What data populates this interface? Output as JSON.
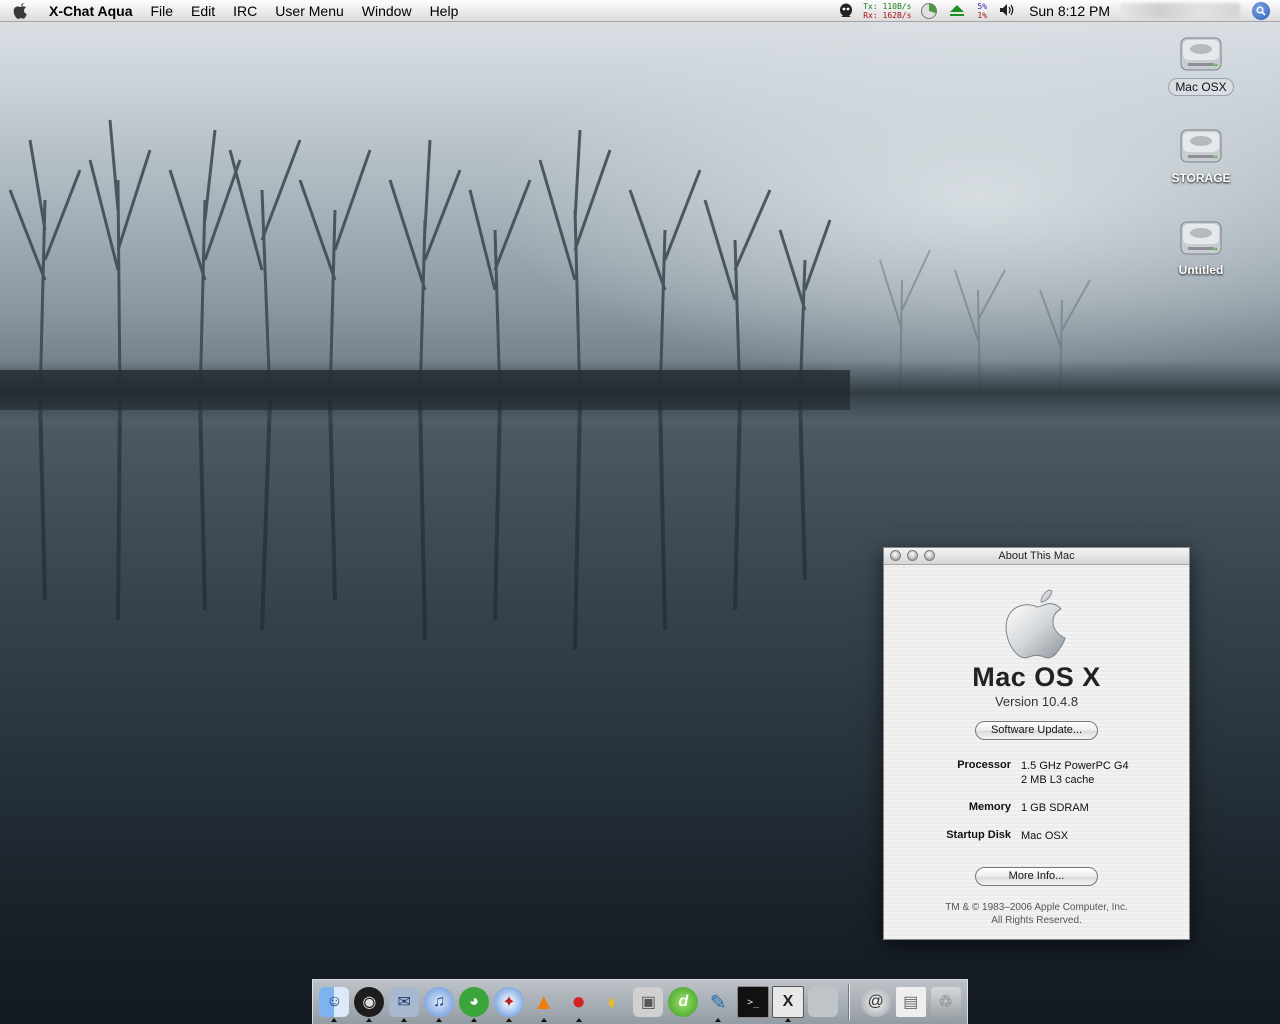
{
  "menubar": {
    "app_name": "X-Chat Aqua",
    "menus": [
      "File",
      "Edit",
      "IRC",
      "User Menu",
      "Window",
      "Help"
    ],
    "net_tx_label": "Tx:",
    "net_tx_value": "110B/s",
    "net_rx_label": "Rx:",
    "net_rx_value": "162B/s",
    "cpu_user": "5%",
    "cpu_sys": "1%",
    "clock": "Sun 8:12 PM",
    "icons": [
      "apple-icon",
      "monitor-eye-icon",
      "pie-chart-icon",
      "upload-arrow-icon",
      "volume-icon",
      "spotlight-icon"
    ]
  },
  "desktop_icons": [
    {
      "label": "Mac OSX",
      "selected": true,
      "icon": "hard-disk-icon"
    },
    {
      "label": "STORAGE",
      "selected": false,
      "icon": "hard-disk-icon"
    },
    {
      "label": "Untitled",
      "selected": false,
      "icon": "hard-disk-icon"
    }
  ],
  "about_window": {
    "title": "About This Mac",
    "os_name": "Mac OS X",
    "version": "Version 10.4.8",
    "software_update_button": "Software Update...",
    "processor_label": "Processor",
    "processor_line1": "1.5 GHz PowerPC G4",
    "processor_line2": "2 MB L3 cache",
    "memory_label": "Memory",
    "memory_value": "1 GB SDRAM",
    "startup_disk_label": "Startup Disk",
    "startup_disk_value": "Mac OSX",
    "more_info_button": "More Info...",
    "copyright_line1": "TM & © 1983–2006 Apple Computer, Inc.",
    "copyright_line2": "All Rights Reserved."
  },
  "dock": {
    "apps": [
      {
        "icon": "finder-icon",
        "glyph": "☺",
        "running": true
      },
      {
        "icon": "dashboard-icon",
        "glyph": "◉",
        "running": true
      },
      {
        "icon": "mail-icon",
        "glyph": "✉",
        "running": true
      },
      {
        "icon": "itunes-icon",
        "glyph": "♫",
        "running": true
      },
      {
        "icon": "adium-icon",
        "glyph": "◕",
        "running": true
      },
      {
        "icon": "safari-compass-icon",
        "glyph": "✦",
        "running": true
      },
      {
        "icon": "vlc-cone-icon",
        "glyph": "▲",
        "running": true
      },
      {
        "icon": "tomato-icon",
        "glyph": "●",
        "running": true
      },
      {
        "icon": "cyberduck-icon",
        "glyph": "◐",
        "running": false
      },
      {
        "icon": "dvd-player-icon",
        "glyph": "▣",
        "running": false
      },
      {
        "icon": "dreamweaver-icon",
        "glyph": "d",
        "running": false
      },
      {
        "icon": "feather-icon",
        "glyph": "✎",
        "running": true
      },
      {
        "icon": "terminal-icon",
        "glyph": ">_",
        "running": false
      },
      {
        "icon": "x11-icon",
        "glyph": "X",
        "running": true
      },
      {
        "icon": "system-preferences-icon",
        "glyph": "",
        "running": false
      }
    ],
    "docs": [
      {
        "icon": "mail-at-icon",
        "glyph": "@"
      },
      {
        "icon": "documents-stack-icon",
        "glyph": "▤"
      },
      {
        "icon": "trash-icon",
        "glyph": "♲"
      }
    ]
  },
  "colors": {
    "menubar_bg": "#ececec",
    "net_tx": "#1a7d1a",
    "net_rx": "#b01010",
    "cpu_user": "#2a2aa8",
    "cpu_sys": "#b01010"
  }
}
